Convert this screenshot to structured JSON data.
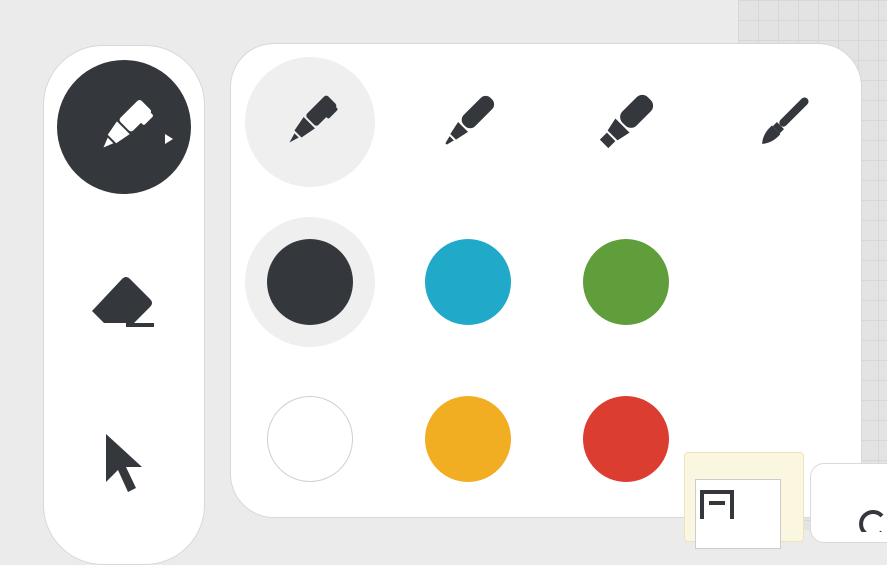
{
  "toolbar": {
    "tools": [
      {
        "name": "pen",
        "icon": "pen-icon",
        "active": true
      },
      {
        "name": "eraser",
        "icon": "eraser-icon",
        "active": false
      },
      {
        "name": "select",
        "icon": "cursor-arrow-icon",
        "active": false
      }
    ]
  },
  "palette": {
    "pen_types": [
      {
        "icon": "fountain-pen-icon",
        "selected": true
      },
      {
        "icon": "marker-icon",
        "selected": false
      },
      {
        "icon": "highlighter-icon",
        "selected": false
      },
      {
        "icon": "paintbrush-icon",
        "selected": false
      }
    ],
    "colors": [
      {
        "name": "black",
        "hex": "#34373c",
        "selected": true
      },
      {
        "name": "blue",
        "hex": "#20a9c9",
        "selected": false
      },
      {
        "name": "green",
        "hex": "#5f9e3a",
        "selected": false
      },
      {
        "name": "white",
        "hex": "#ffffff",
        "selected": false
      },
      {
        "name": "yellow",
        "hex": "#f2ae23",
        "selected": false
      },
      {
        "name": "red",
        "hex": "#dc3d31",
        "selected": false
      }
    ]
  },
  "colors": {
    "icon_dark": "#34373c",
    "panel_border": "#d8d8d8",
    "selection_bg": "#efefef"
  }
}
